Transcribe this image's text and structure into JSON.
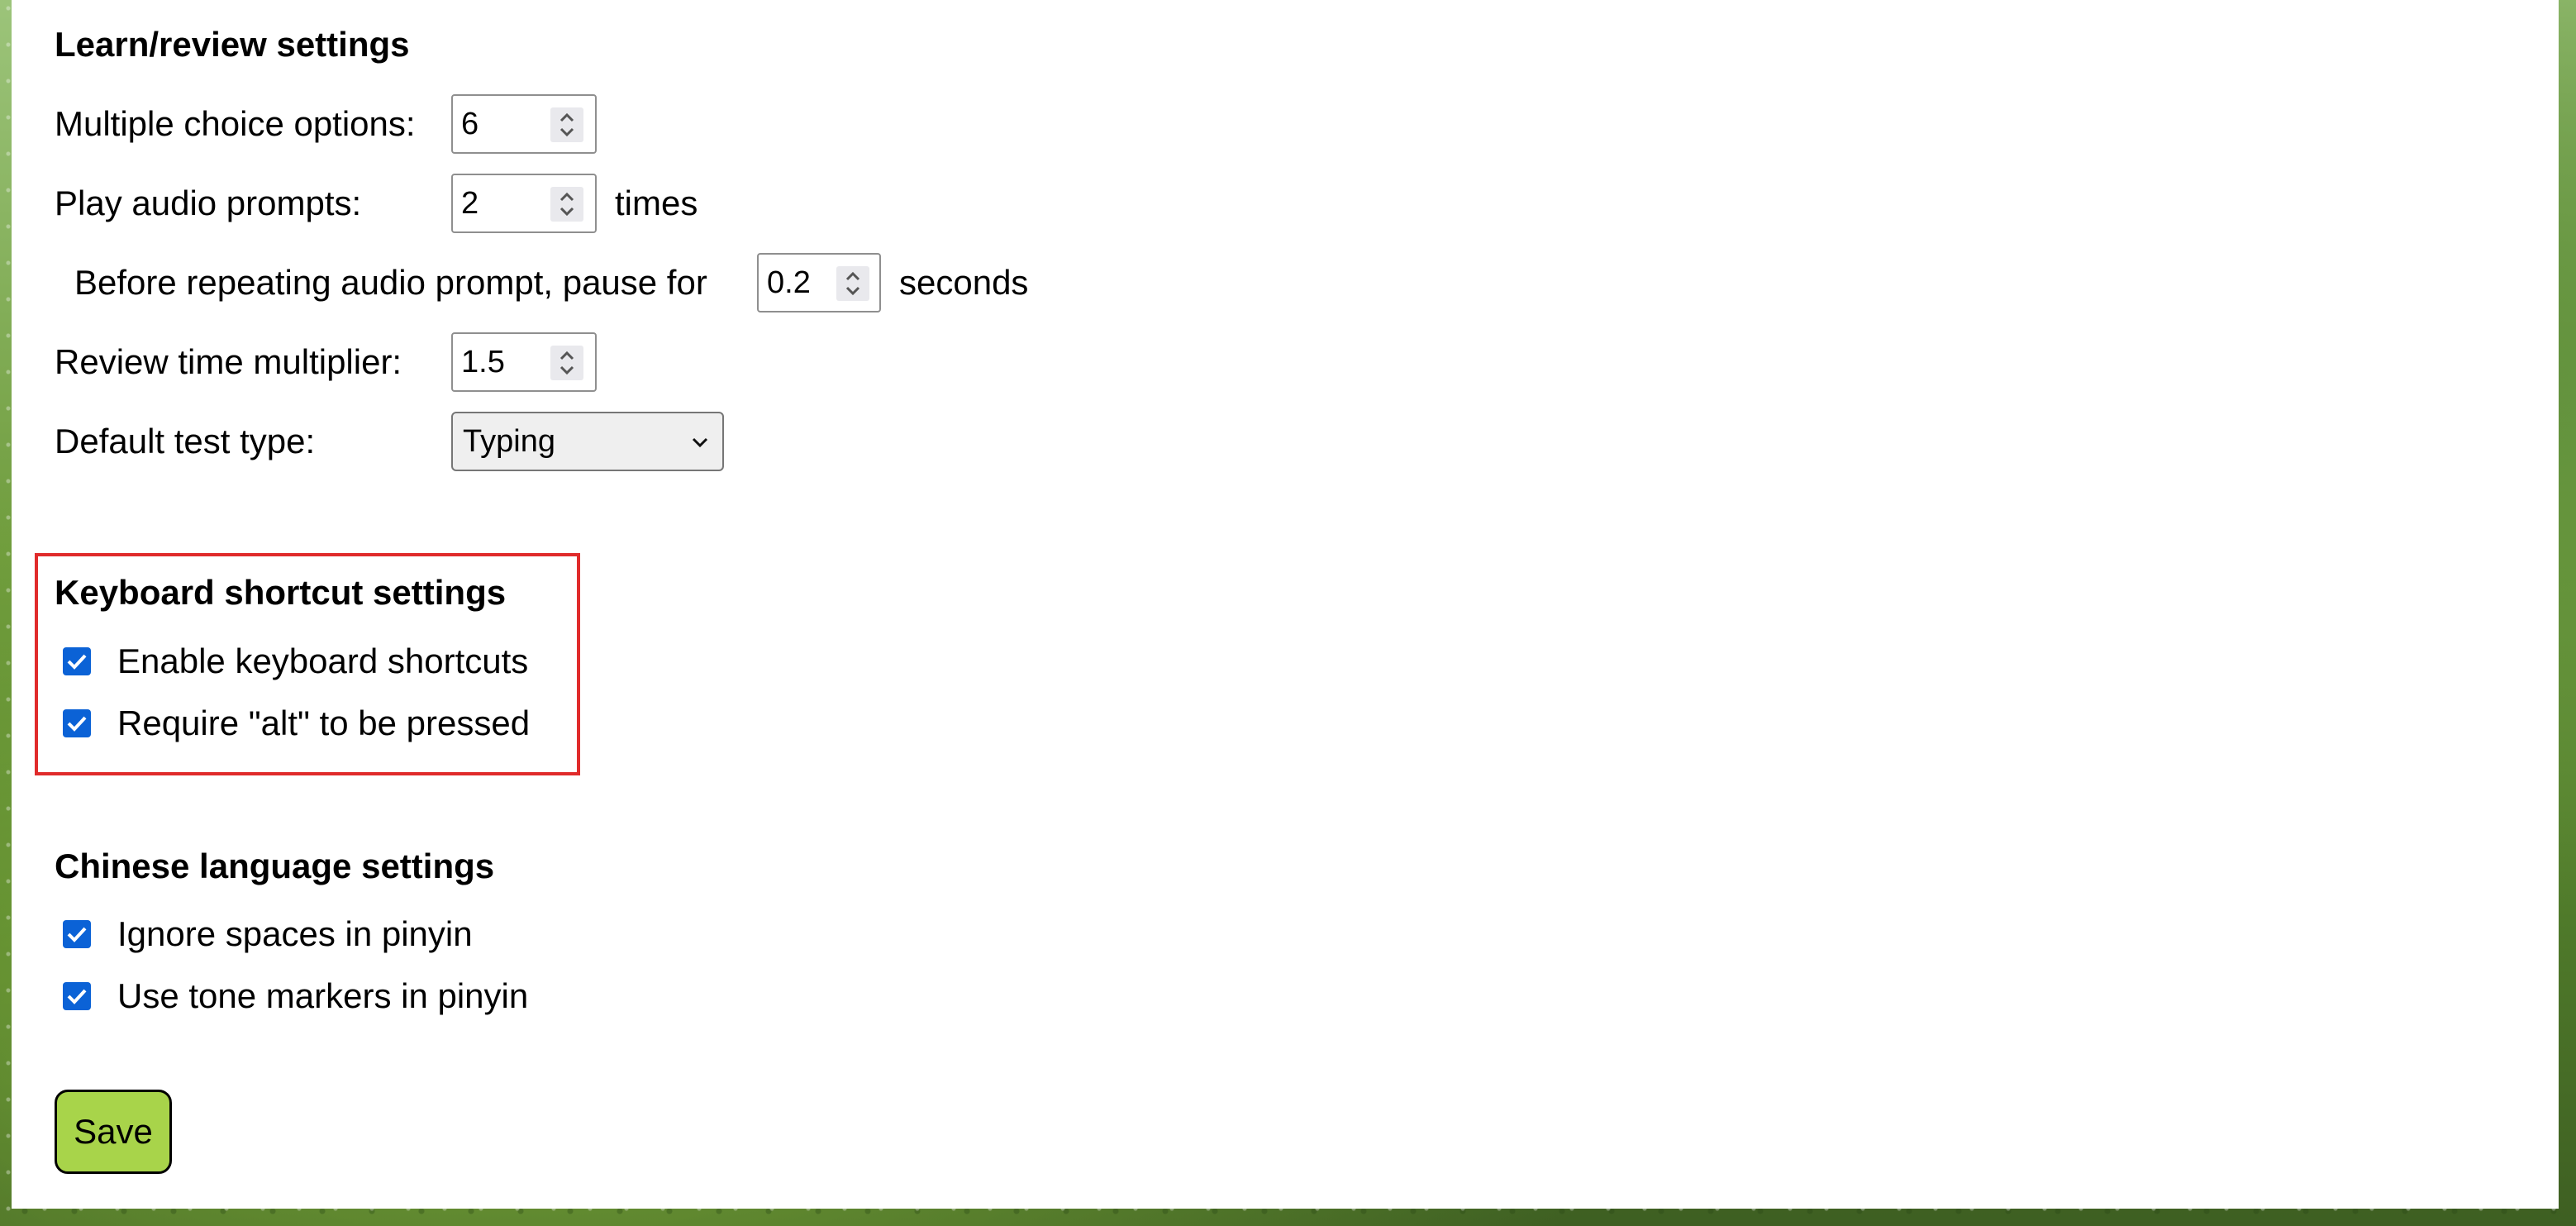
{
  "learn_review": {
    "heading": "Learn/review settings",
    "multiple_choice": {
      "label": "Multiple choice options:",
      "value": "6"
    },
    "play_audio": {
      "label": "Play audio prompts:",
      "value": "2",
      "suffix": "times"
    },
    "pause": {
      "label": "Before repeating audio prompt, pause for",
      "value": "0.2",
      "suffix": "seconds"
    },
    "review_multiplier": {
      "label": "Review time multiplier:",
      "value": "1.5"
    },
    "default_test_type": {
      "label": "Default test type:",
      "selected": "Typing"
    }
  },
  "keyboard": {
    "heading": "Keyboard shortcut settings",
    "enable_shortcuts": {
      "label": "Enable keyboard shortcuts",
      "checked": true
    },
    "require_alt": {
      "label": "Require \"alt\" to be pressed",
      "checked": true
    }
  },
  "chinese": {
    "heading": "Chinese language settings",
    "ignore_spaces": {
      "label": "Ignore spaces in pinyin",
      "checked": true
    },
    "tone_markers": {
      "label": "Use tone markers in pinyin",
      "checked": true
    }
  },
  "save_label": "Save",
  "colors": {
    "checkbox": "#0b62d6",
    "highlight_border": "#e02b2b",
    "save_button": "#a8d44a"
  }
}
